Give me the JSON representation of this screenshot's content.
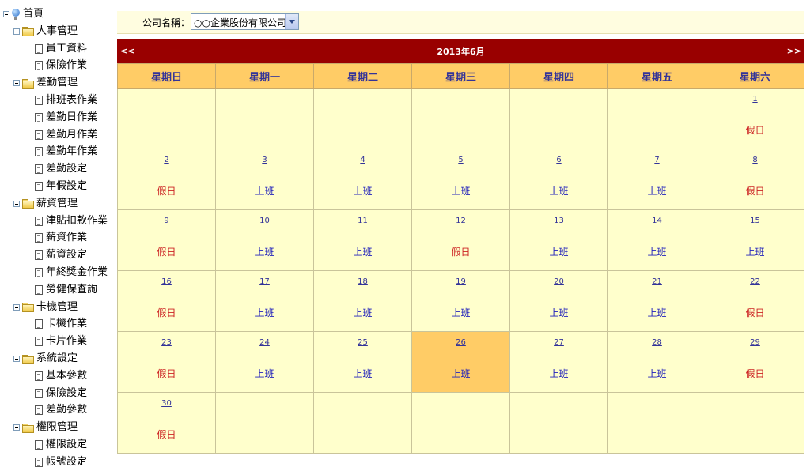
{
  "tree": [
    {
      "type": "root",
      "label": "首頁"
    },
    {
      "type": "folder",
      "label": "人事管理"
    },
    {
      "type": "leaf",
      "label": "員工資料"
    },
    {
      "type": "leaf",
      "label": "保險作業"
    },
    {
      "type": "folder",
      "label": "差勤管理"
    },
    {
      "type": "leaf",
      "label": "排班表作業"
    },
    {
      "type": "leaf",
      "label": "差勤日作業"
    },
    {
      "type": "leaf",
      "label": "差勤月作業"
    },
    {
      "type": "leaf",
      "label": "差勤年作業"
    },
    {
      "type": "leaf",
      "label": "差勤設定"
    },
    {
      "type": "leaf",
      "label": "年假設定"
    },
    {
      "type": "folder",
      "label": "薪資管理"
    },
    {
      "type": "leaf",
      "label": "津貼扣款作業"
    },
    {
      "type": "leaf",
      "label": "薪資作業"
    },
    {
      "type": "leaf",
      "label": "薪資設定"
    },
    {
      "type": "leaf",
      "label": "年終獎金作業"
    },
    {
      "type": "leaf",
      "label": "勞健保查詢"
    },
    {
      "type": "folder",
      "label": "卡機管理"
    },
    {
      "type": "leaf",
      "label": "卡機作業"
    },
    {
      "type": "leaf",
      "label": "卡片作業"
    },
    {
      "type": "folder",
      "label": "系統設定"
    },
    {
      "type": "leaf",
      "label": "基本參數"
    },
    {
      "type": "leaf",
      "label": "保險設定"
    },
    {
      "type": "leaf",
      "label": "差勤參數"
    },
    {
      "type": "folder",
      "label": "權限管理"
    },
    {
      "type": "leaf",
      "label": "權限設定"
    },
    {
      "type": "leaf",
      "label": "帳號設定"
    }
  ],
  "company": {
    "label": "公司名稱：",
    "value": "○○企業股份有限公司"
  },
  "calendar": {
    "prev": "<<",
    "next": ">>",
    "title": "2013年6月",
    "weekdays": [
      "星期日",
      "星期一",
      "星期二",
      "星期三",
      "星期四",
      "星期五",
      "星期六"
    ],
    "today": 26,
    "weeks": [
      [
        null,
        null,
        null,
        null,
        null,
        null,
        {
          "day": "1",
          "status": "假日",
          "kind": "off"
        }
      ],
      [
        {
          "day": "2",
          "status": "假日",
          "kind": "off"
        },
        {
          "day": "3",
          "status": "上班",
          "kind": "work"
        },
        {
          "day": "4",
          "status": "上班",
          "kind": "work"
        },
        {
          "day": "5",
          "status": "上班",
          "kind": "work"
        },
        {
          "day": "6",
          "status": "上班",
          "kind": "work"
        },
        {
          "day": "7",
          "status": "上班",
          "kind": "work"
        },
        {
          "day": "8",
          "status": "假日",
          "kind": "off"
        }
      ],
      [
        {
          "day": "9",
          "status": "假日",
          "kind": "off"
        },
        {
          "day": "10",
          "status": "上班",
          "kind": "work"
        },
        {
          "day": "11",
          "status": "上班",
          "kind": "work"
        },
        {
          "day": "12",
          "status": "假日",
          "kind": "off"
        },
        {
          "day": "13",
          "status": "上班",
          "kind": "work"
        },
        {
          "day": "14",
          "status": "上班",
          "kind": "work"
        },
        {
          "day": "15",
          "status": "上班",
          "kind": "work"
        }
      ],
      [
        {
          "day": "16",
          "status": "假日",
          "kind": "off"
        },
        {
          "day": "17",
          "status": "上班",
          "kind": "work"
        },
        {
          "day": "18",
          "status": "上班",
          "kind": "work"
        },
        {
          "day": "19",
          "status": "上班",
          "kind": "work"
        },
        {
          "day": "20",
          "status": "上班",
          "kind": "work"
        },
        {
          "day": "21",
          "status": "上班",
          "kind": "work"
        },
        {
          "day": "22",
          "status": "假日",
          "kind": "off"
        }
      ],
      [
        {
          "day": "23",
          "status": "假日",
          "kind": "off"
        },
        {
          "day": "24",
          "status": "上班",
          "kind": "work"
        },
        {
          "day": "25",
          "status": "上班",
          "kind": "work"
        },
        {
          "day": "26",
          "status": "上班",
          "kind": "work"
        },
        {
          "day": "27",
          "status": "上班",
          "kind": "work"
        },
        {
          "day": "28",
          "status": "上班",
          "kind": "work"
        },
        {
          "day": "29",
          "status": "假日",
          "kind": "off"
        }
      ],
      [
        {
          "day": "30",
          "status": "假日",
          "kind": "off"
        },
        null,
        null,
        null,
        null,
        null,
        null
      ]
    ]
  }
}
